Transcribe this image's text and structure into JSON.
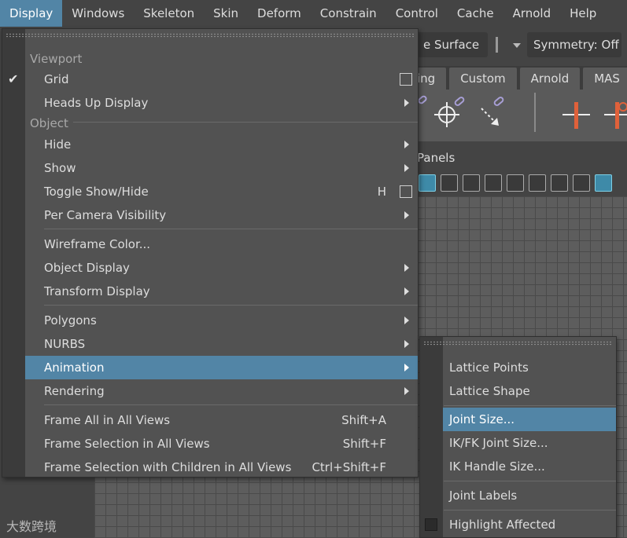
{
  "menubar": {
    "items": [
      "Display",
      "Windows",
      "Skeleton",
      "Skin",
      "Deform",
      "Constrain",
      "Control",
      "Cache",
      "Arnold",
      "Help"
    ],
    "active": "Display"
  },
  "background": {
    "surface_field": "e Surface",
    "symmetry_field": "Symmetry: Off",
    "shelf_tabs": [
      "ing",
      "Custom",
      "Arnold",
      "MAS"
    ],
    "panel_label": "Panels",
    "watermark": "大数跨境"
  },
  "main_menu": {
    "sections": {
      "viewport": "Viewport",
      "object": "Object"
    },
    "items": {
      "grid": "Grid",
      "heads_up": "Heads Up Display",
      "hide": "Hide",
      "show": "Show",
      "toggle": "Toggle Show/Hide",
      "toggle_shortcut": "H",
      "per_camera": "Per Camera Visibility",
      "wire_color": "Wireframe Color...",
      "object_display": "Object Display",
      "transform_display": "Transform Display",
      "polygons": "Polygons",
      "nurbs": "NURBS",
      "animation": "Animation",
      "rendering": "Rendering",
      "frame_all": "Frame All in All Views",
      "frame_all_shortcut": "Shift+A",
      "frame_sel": "Frame Selection in All Views",
      "frame_sel_shortcut": "Shift+F",
      "frame_sel_children": "Frame Selection with Children in All Views",
      "frame_sel_children_shortcut": "Ctrl+Shift+F"
    }
  },
  "sub_menu": {
    "items": {
      "lattice_points": "Lattice Points",
      "lattice_shape": "Lattice Shape",
      "joint_size": "Joint Size...",
      "ikfk_joint_size": "IK/FK Joint Size...",
      "ik_handle_size": "IK Handle Size...",
      "joint_labels": "Joint Labels",
      "highlight_affected": "Highlight Affected"
    }
  },
  "colors": {
    "highlight": "#5285a6",
    "menu_bg": "#525252",
    "accent_orange": "#e0613a"
  }
}
